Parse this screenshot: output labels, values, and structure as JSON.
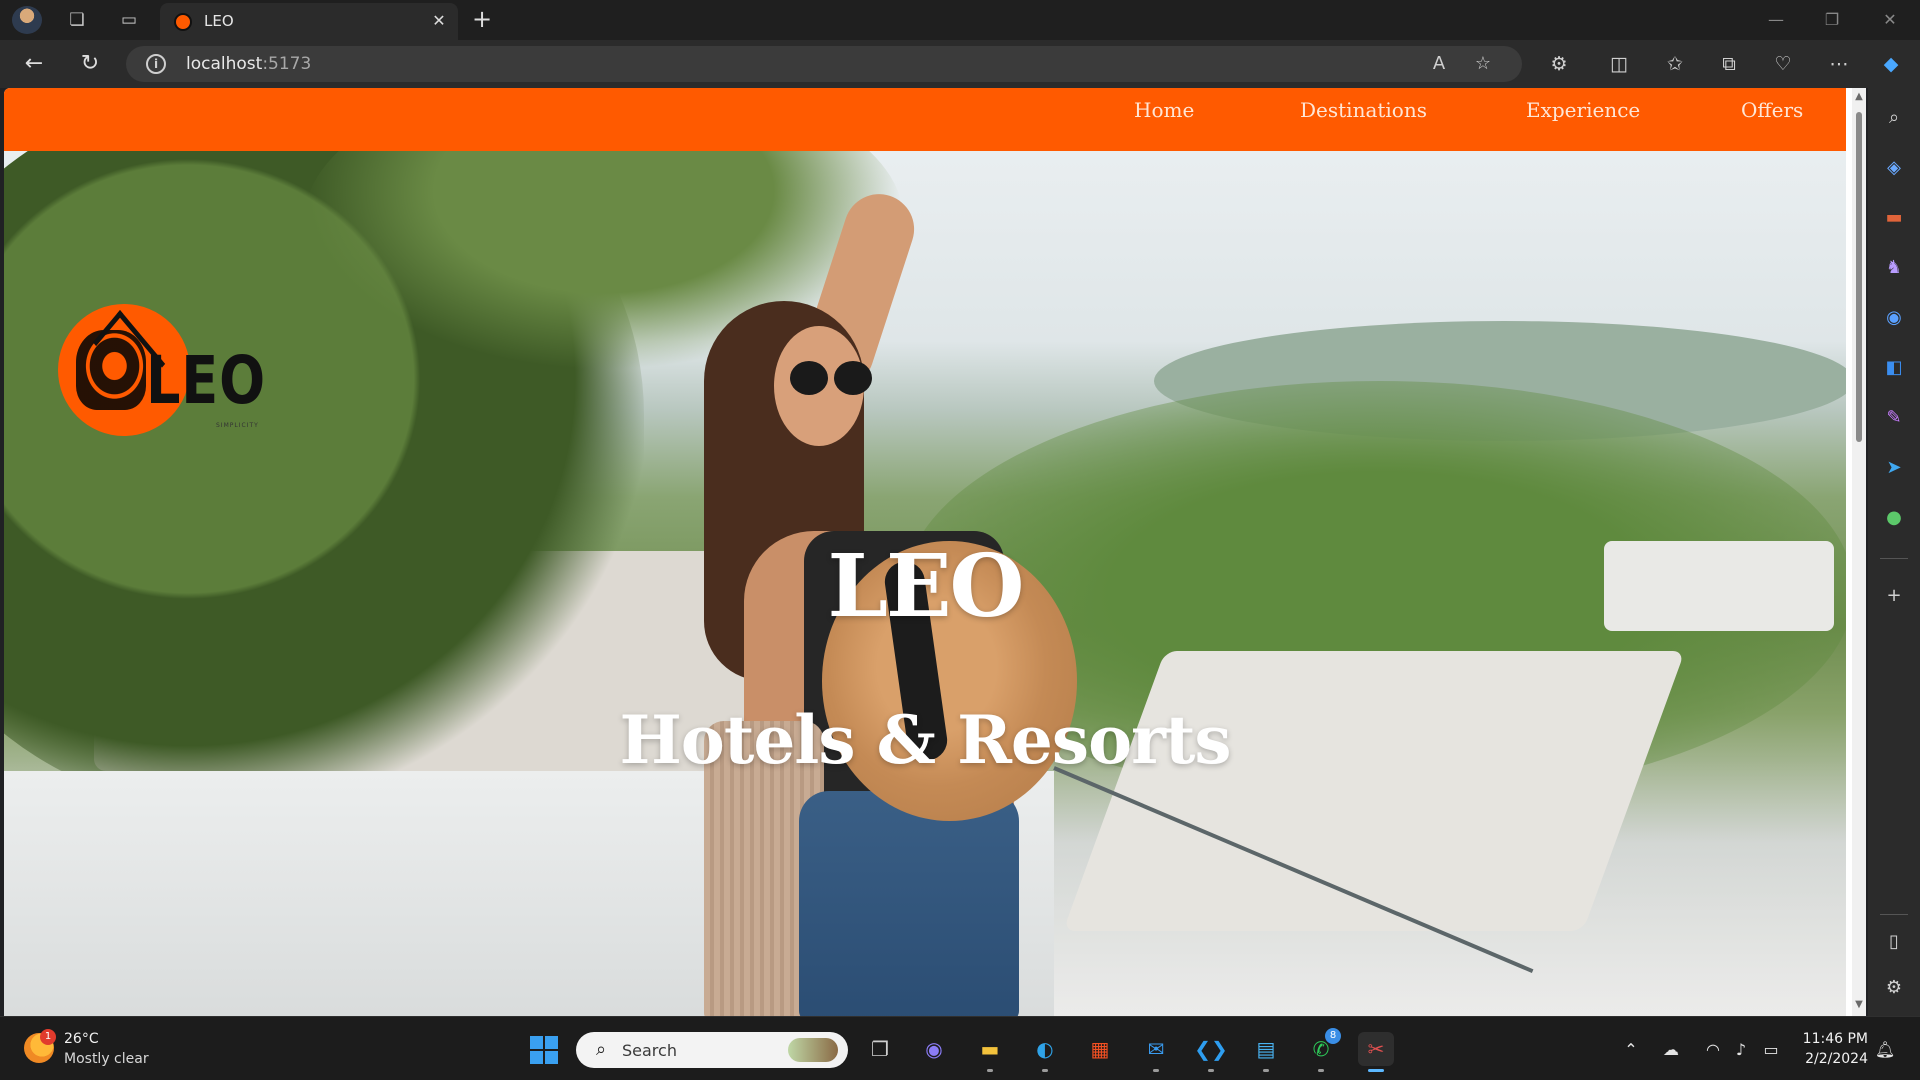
{
  "browser": {
    "tab": {
      "title": "LEO",
      "close_glyph": "✕"
    },
    "new_tab_glyph": "+",
    "window_controls": {
      "minimize": "—",
      "restore": "❐",
      "close": "✕"
    },
    "address": {
      "host": "localhost",
      "port": ":5173"
    },
    "icons": {
      "profile": "profile-avatar-icon",
      "workspaces": "workspaces-icon",
      "tab_actions": "tab-actions-icon",
      "back": "back-arrow-icon",
      "refresh": "refresh-icon",
      "site_info": "info-icon",
      "read_aloud": "read-aloud-icon",
      "favorite": "star-icon",
      "extensions": "extensions-icon",
      "split_screen": "split-screen-icon",
      "favorites": "favorites-icon",
      "collections": "collections-icon",
      "browser_essentials": "heart-pulse-icon",
      "more": "more-icon",
      "copilot": "copilot-icon"
    },
    "sidebar_icons": [
      "search-icon",
      "shopping-tag-icon",
      "tools-icon",
      "games-icon",
      "copilot-app-icon",
      "outlook-icon",
      "designer-icon",
      "send-icon",
      "drop-icon",
      "add-icon",
      "sidebar-panel-icon",
      "settings-icon"
    ]
  },
  "site": {
    "nav": {
      "home": "Home",
      "destinations": "Destinations",
      "experience": "Experience",
      "offers": "Offers"
    },
    "logo_text": "LEO",
    "logo_sub": "SIMPLICITY",
    "hero_title": "LEO",
    "hero_subtitle": "Hotels & Resorts",
    "brand_color": "#ff5a00"
  },
  "taskbar": {
    "weather": {
      "badge": "1",
      "temp": "26°C",
      "desc": "Mostly clear"
    },
    "search_placeholder": "Search",
    "apps": [
      "start-icon",
      "task-view-icon",
      "teams-chat-icon",
      "file-explorer-icon",
      "edge-icon",
      "store-icon",
      "mail-icon",
      "vscode-icon",
      "notepad-icon",
      "whatsapp-icon",
      "snipping-tool-icon"
    ],
    "whatsapp_badge": "8",
    "tray": [
      "chevron-up-icon",
      "onedrive-icon",
      "wifi-icon",
      "volume-icon",
      "battery-icon",
      "notification-bell-icon"
    ],
    "clock": {
      "time": "11:46 PM",
      "date": "2/2/2024"
    }
  }
}
